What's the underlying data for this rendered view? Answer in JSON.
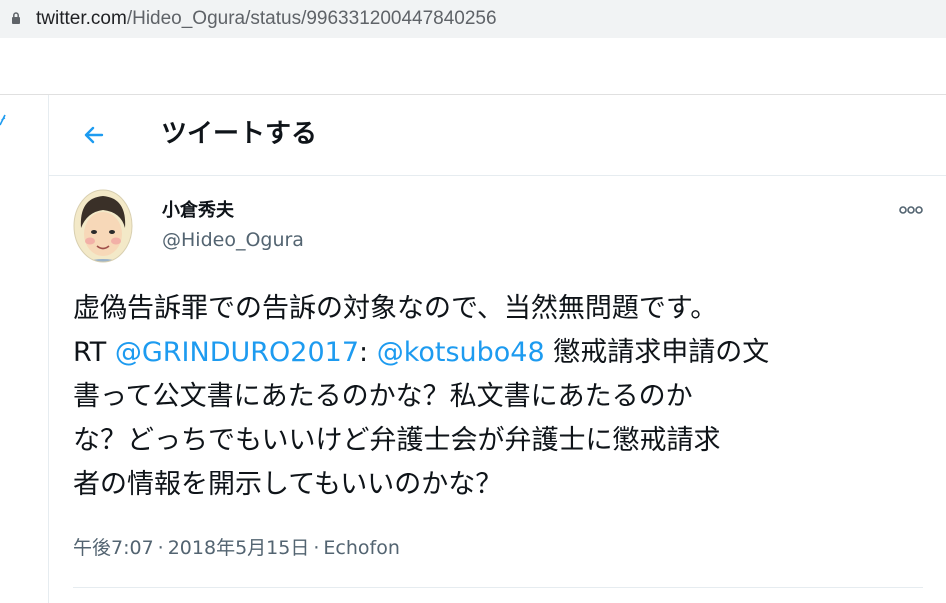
{
  "browser": {
    "url_host": "twitter.com",
    "url_path": "/Hideo_Ogura/status/996331200447840256"
  },
  "header": {
    "title": "ツイートする"
  },
  "tweet": {
    "display_name": "小倉秀夫",
    "handle": "@Hideo_Ogura",
    "lines": {
      "l1": "虚偽告訴罪での告訴の対象なので、当然無問題です。",
      "l2_prefix": "RT ",
      "l2_mention1": "@GRINDURO2017",
      "l2_colon": ": ",
      "l2_mention2": "@kotsubo48",
      "l2_suffix": " 懲戒請求申請の文",
      "l3": "書って公文書にあたるのかな？私文書にあたるのか",
      "l4": "な？どっちでもいいけど弁護士会が弁護士に懲戒請求",
      "l5": "者の情報を開示してもいいのかな？"
    },
    "time": "午後7:07",
    "separator": "·",
    "date": "2018年5月15日",
    "source": "Echofon"
  },
  "colors": {
    "accent": "#1d9bf0",
    "muted": "#536471",
    "border": "#e6ecf0"
  },
  "icons": {
    "lock": "lock-icon",
    "back": "back-arrow-icon",
    "more": "more-icon"
  }
}
